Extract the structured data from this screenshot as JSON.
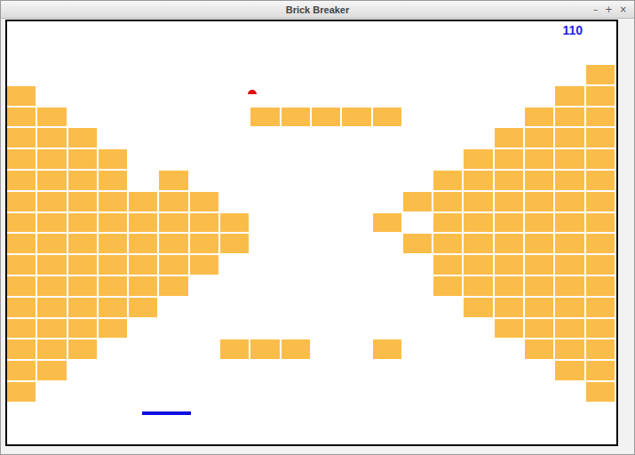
{
  "window": {
    "title": "Brick Breaker",
    "controls": [
      "–",
      "+",
      "×"
    ]
  },
  "game": {
    "score": "110",
    "brick_rows": [
      [
        false,
        false,
        false,
        false,
        false,
        false,
        false,
        false,
        false,
        false,
        false,
        false,
        false,
        false,
        false,
        false,
        false,
        false,
        false,
        true
      ],
      [
        true,
        false,
        false,
        false,
        false,
        false,
        false,
        false,
        false,
        false,
        false,
        false,
        false,
        false,
        false,
        false,
        false,
        false,
        true,
        true
      ],
      [
        true,
        true,
        false,
        false,
        false,
        false,
        false,
        false,
        true,
        true,
        true,
        true,
        true,
        false,
        false,
        false,
        false,
        true,
        true,
        true
      ],
      [
        true,
        true,
        true,
        false,
        false,
        false,
        false,
        false,
        false,
        false,
        false,
        false,
        false,
        false,
        false,
        false,
        true,
        true,
        true,
        true
      ],
      [
        true,
        true,
        true,
        true,
        false,
        false,
        false,
        false,
        false,
        false,
        false,
        false,
        false,
        false,
        false,
        true,
        true,
        true,
        true,
        true
      ],
      [
        true,
        true,
        true,
        true,
        false,
        true,
        false,
        false,
        false,
        false,
        false,
        false,
        false,
        false,
        true,
        true,
        true,
        true,
        true,
        true
      ],
      [
        true,
        true,
        true,
        true,
        true,
        true,
        true,
        false,
        false,
        false,
        false,
        false,
        false,
        true,
        true,
        true,
        true,
        true,
        true,
        true
      ],
      [
        true,
        true,
        true,
        true,
        true,
        true,
        true,
        true,
        false,
        false,
        false,
        false,
        true,
        false,
        true,
        true,
        true,
        true,
        true,
        true
      ],
      [
        true,
        true,
        true,
        true,
        true,
        true,
        true,
        true,
        false,
        false,
        false,
        false,
        false,
        true,
        true,
        true,
        true,
        true,
        true,
        true
      ],
      [
        true,
        true,
        true,
        true,
        true,
        true,
        true,
        false,
        false,
        false,
        false,
        false,
        false,
        false,
        true,
        true,
        true,
        true,
        true,
        true
      ],
      [
        true,
        true,
        true,
        true,
        true,
        true,
        false,
        false,
        false,
        false,
        false,
        false,
        false,
        false,
        true,
        true,
        true,
        true,
        true,
        true
      ],
      [
        true,
        true,
        true,
        true,
        true,
        false,
        false,
        false,
        false,
        false,
        false,
        false,
        false,
        false,
        false,
        true,
        true,
        true,
        true,
        true
      ],
      [
        true,
        true,
        true,
        true,
        false,
        false,
        false,
        false,
        false,
        false,
        false,
        false,
        false,
        false,
        false,
        false,
        true,
        true,
        true,
        true
      ],
      [
        true,
        true,
        true,
        false,
        false,
        false,
        false,
        true,
        true,
        true,
        false,
        false,
        true,
        false,
        false,
        false,
        false,
        true,
        true,
        true
      ],
      [
        true,
        true,
        false,
        false,
        false,
        false,
        false,
        false,
        false,
        false,
        false,
        false,
        false,
        false,
        false,
        false,
        false,
        false,
        true,
        true
      ],
      [
        true,
        false,
        false,
        false,
        false,
        false,
        false,
        false,
        false,
        false,
        false,
        false,
        false,
        false,
        false,
        false,
        false,
        false,
        false,
        true
      ]
    ]
  }
}
